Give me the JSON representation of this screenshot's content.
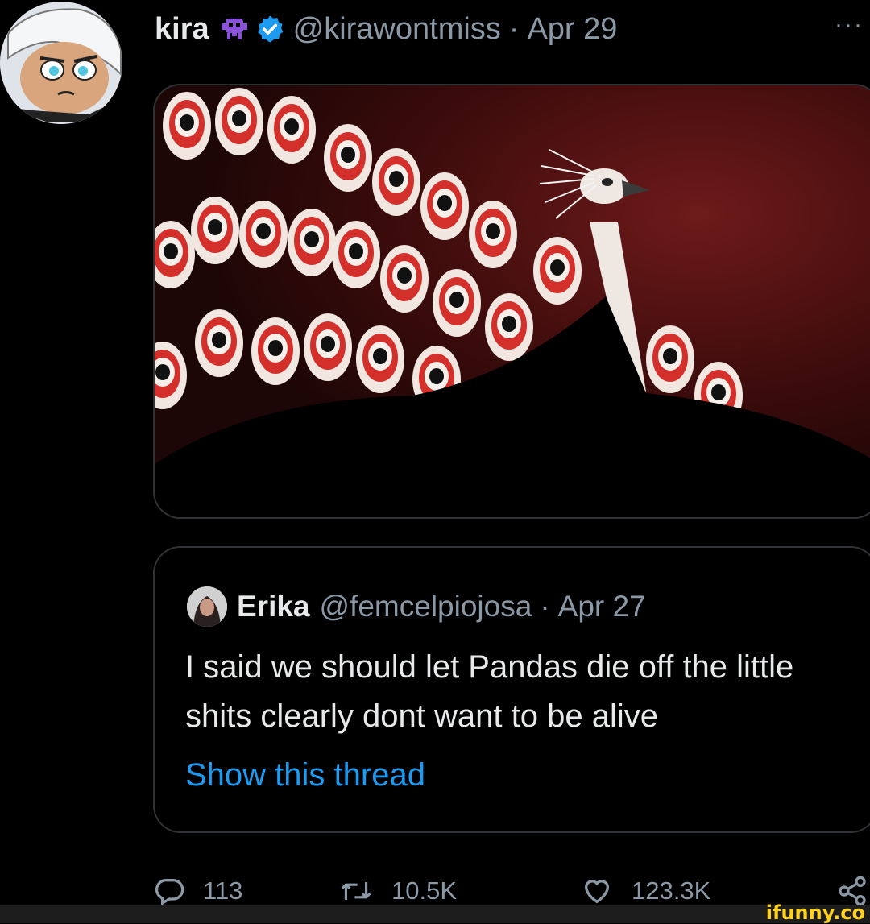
{
  "tweet": {
    "display_name": "kira",
    "emoji_icon": "alien-monster-icon",
    "verified_icon": "verified-badge-icon",
    "handle": "@kirawontmiss",
    "separator": "·",
    "date": "Apr 29",
    "more_label": "···"
  },
  "quoted": {
    "display_name": "Erika",
    "handle": "@femcelpiojosa",
    "separator": "·",
    "date": "Apr 27",
    "text": "I said we should let Pandas die off the little shits clearly dont want to be alive",
    "show_thread": "Show this thread"
  },
  "actions": {
    "replies": "113",
    "retweets": "10.5K",
    "likes": "123.3K"
  },
  "watermark": "ifunny.co",
  "colors": {
    "background": "#000000",
    "text": "#e7e9ea",
    "muted": "#8b98a5",
    "link": "#1d9bf0",
    "verified": "#1d9bf0",
    "border": "#2f3336"
  }
}
